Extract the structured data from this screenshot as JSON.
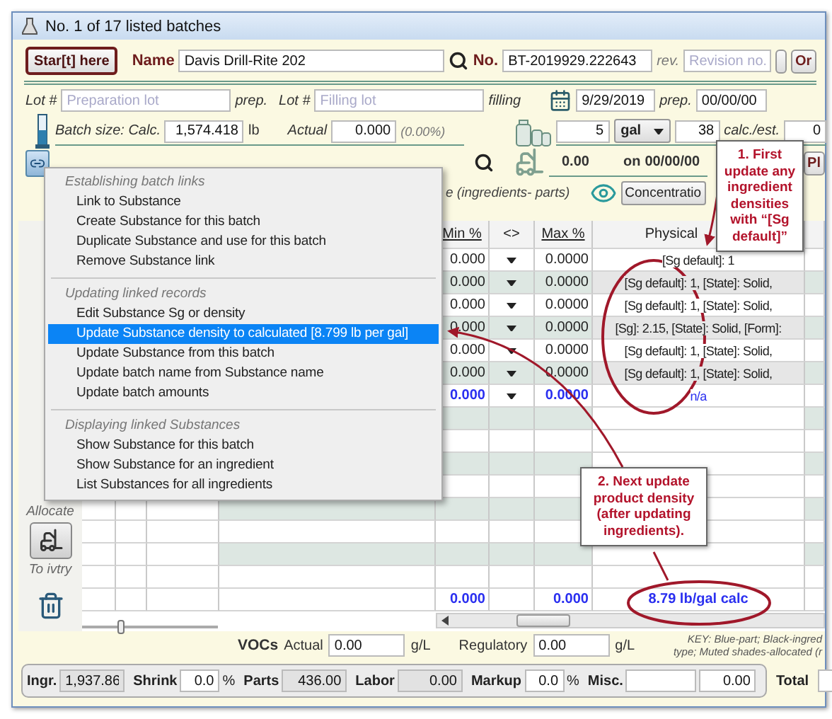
{
  "window": {
    "title": "No. 1 of 17 listed batches"
  },
  "header": {
    "start_button": "Star[t] here",
    "name_label": "Name",
    "name_value": "Davis Drill-Rite 202",
    "number_label": "No.",
    "number_value": "BT-2019929.222643",
    "rev_label": "rev.",
    "rev_placeholder": "Revision no.",
    "cut_button": "Or"
  },
  "lots": {
    "lot_label_1": "Lot #",
    "prep_placeholder": "Preparation lot",
    "prep_label": "prep.",
    "lot_label_2": "Lot #",
    "filling_placeholder": "Filling lot",
    "filling_label": "filling",
    "date": "9/29/2019",
    "date_label": "prep.",
    "date_2": "00/00/00"
  },
  "size": {
    "label": "Batch size: Calc.",
    "calc": "1,574.418",
    "unit": "lb",
    "actual_label": "Actual",
    "actual": "0.000",
    "percent": "(0.00%)",
    "count": "5",
    "container_unit": "gal",
    "containers": "38",
    "est_label": "calc./est.",
    "est_value": "0"
  },
  "inventory": {
    "amount": "0.00",
    "on_label": "on",
    "date": "00/00/00",
    "cut_button": "Pl"
  },
  "ingredients_bar": {
    "caption": "e (ingredients- parts)",
    "view_button": "Concentratio"
  },
  "table": {
    "columns": [
      "Min %",
      "<>",
      "Max %",
      "Physical"
    ],
    "rows": [
      {
        "kind": "ingredient",
        "min": "0.000",
        "max": "0.0000",
        "physical": "[Sg default]: 1"
      },
      {
        "kind": "ingredient",
        "min": "0.000",
        "max": "0.0000",
        "physical": "[Sg default]: 1, [State]: Solid,"
      },
      {
        "kind": "ingredient",
        "min": "0.000",
        "max": "0.0000",
        "physical": "[Sg default]: 1, [State]: Solid,"
      },
      {
        "kind": "ingredient",
        "min": "0.000",
        "max": "0.0000",
        "physical": "[Sg]: 2.15, [State]: Solid, [Form]:"
      },
      {
        "kind": "ingredient",
        "min": "0.000",
        "max": "0.0000",
        "physical": "[Sg default]: 1, [State]: Solid,"
      },
      {
        "kind": "ingredient",
        "min": "0.000",
        "max": "0.0000",
        "physical": "[Sg default]: 1, [State]: Solid,"
      },
      {
        "kind": "part",
        "min": "0.000",
        "max": "0.0000",
        "physical": "n/a"
      }
    ],
    "totals": {
      "min": "0.000",
      "max": "0.000",
      "physical": "8.79 lb/gal calc"
    }
  },
  "side": {
    "allocate_label": "Allocate",
    "inventory_label": "To ivtry"
  },
  "slider": {
    "level": 0.28
  },
  "vocs": {
    "label": "VOCs",
    "actual_label": "Actual",
    "actual": "0.00",
    "unit_1": "g/L",
    "regulatory_label": "Regulatory",
    "regulatory": "0.00",
    "unit_2": "g/L"
  },
  "key": [
    "KEY: Blue-part; Black-ingred",
    "type; Muted shades-allocated (r"
  ],
  "summary": [
    {
      "kind": "readonly",
      "label": "Ingr.",
      "value": "1,937.86"
    },
    {
      "kind": "input",
      "label": "Shrink",
      "value": "0.0",
      "suffix": "%"
    },
    {
      "kind": "readonly",
      "label": "Parts",
      "value": "436.00"
    },
    {
      "kind": "readonly",
      "label": "Labor",
      "value": "0.00"
    },
    {
      "kind": "input",
      "label": "Markup",
      "value": "0.0",
      "suffix": "%"
    },
    {
      "kind": "misc",
      "label": "Misc.",
      "value": "0.00"
    }
  ],
  "total_label": "Total",
  "context_menu": {
    "sections": [
      {
        "heading": "Establishing batch links",
        "items": [
          {
            "label": "Link to Substance",
            "selected": false
          },
          {
            "label": "Create Substance for this batch",
            "selected": false
          },
          {
            "label": "Duplicate Substance and use for this batch",
            "selected": false
          },
          {
            "label": "Remove Substance link",
            "selected": false
          }
        ]
      },
      {
        "heading": "Updating linked records",
        "items": [
          {
            "label": "Edit Substance Sg or density",
            "selected": false
          },
          {
            "label": "Update Substance density to calculated [8.799 lb per gal]",
            "selected": true
          },
          {
            "label": "Update Substance from this batch",
            "selected": false
          },
          {
            "label": "Update batch name from Substance name",
            "selected": false
          },
          {
            "label": "Update batch amounts",
            "selected": false
          }
        ]
      },
      {
        "heading": "Displaying linked Substances",
        "items": [
          {
            "label": "Show Substance for this batch",
            "selected": false
          },
          {
            "label": "Show Substance for an ingredient",
            "selected": false
          },
          {
            "label": "List Substances for all ingredients",
            "selected": false
          }
        ]
      }
    ]
  },
  "callouts": [
    "1. First update any ingredient densities with “[Sg default]”",
    "2. Next update product density (after updating ingredients)."
  ]
}
